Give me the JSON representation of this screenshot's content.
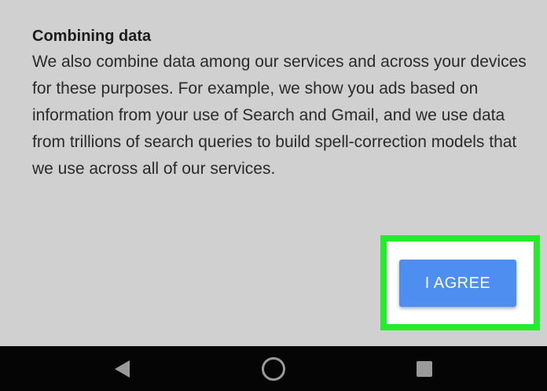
{
  "content": {
    "heading": "Combining data",
    "body": "We also combine data among our services and across your devices for these purposes. For example, we show you ads based on information from your use of Search and Gmail, and we use data from trillions of search queries to build spell-correction models that we use across all of our services."
  },
  "agree_button": {
    "label": "I AGREE"
  },
  "colors": {
    "background": "#d0d0d0",
    "button": "#4e8ef0",
    "highlight": "#23ec2a",
    "nav_bar": "#050505",
    "nav_icon": "#9a9a9a"
  },
  "nav": {
    "icons": [
      "back-icon",
      "home-icon",
      "recents-icon"
    ]
  }
}
